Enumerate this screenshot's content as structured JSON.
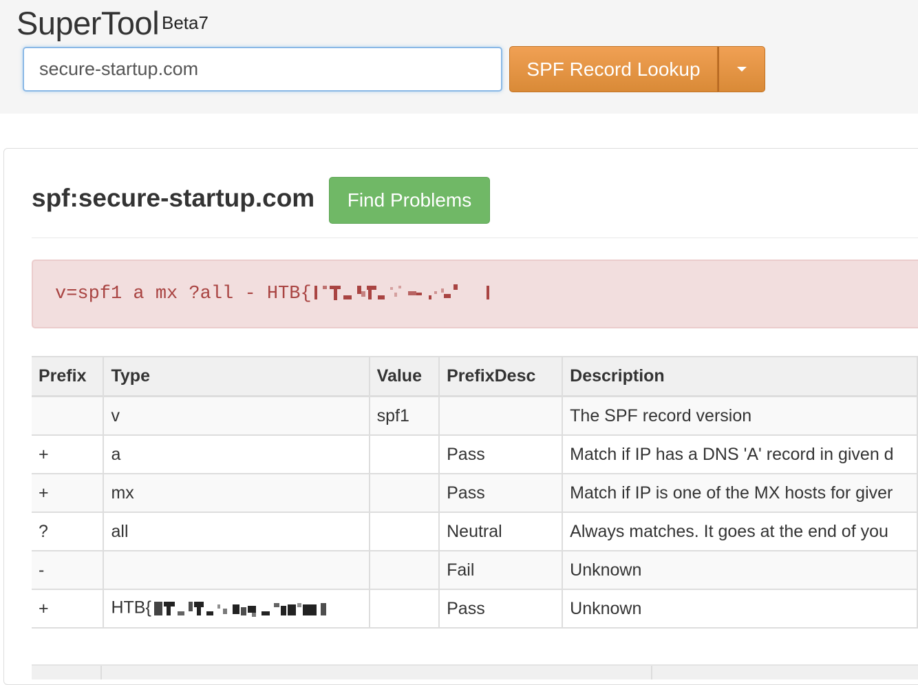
{
  "header": {
    "brand": "SuperTool",
    "beta": "Beta7",
    "search_value": "secure-startup.com",
    "lookup_label": "SPF Record Lookup"
  },
  "result": {
    "title": "spf:secure-startup.com",
    "find_problems_label": "Find Problems",
    "record_text": "v=spf1 a mx ?all - HTB{"
  },
  "table": {
    "columns": [
      "Prefix",
      "Type",
      "Value",
      "PrefixDesc",
      "Description"
    ],
    "rows": [
      [
        "",
        "v",
        "spf1",
        "",
        "The SPF record version"
      ],
      [
        "+",
        "a",
        "",
        "Pass",
        "Match if IP has a DNS 'A' record in given d"
      ],
      [
        "+",
        "mx",
        "",
        "Pass",
        "Match if IP is one of the MX hosts for giver"
      ],
      [
        "?",
        "all",
        "",
        "Neutral",
        "Always matches. It goes at the end of you"
      ],
      [
        "-",
        "",
        "",
        "Fail",
        "Unknown"
      ],
      [
        "+",
        "HTB{",
        "",
        "Pass",
        "Unknown"
      ]
    ]
  },
  "colors": {
    "accent_orange": "#e6954a",
    "success_green": "#70b866",
    "alert_bg": "#f2dede",
    "alert_text": "#a94442"
  }
}
